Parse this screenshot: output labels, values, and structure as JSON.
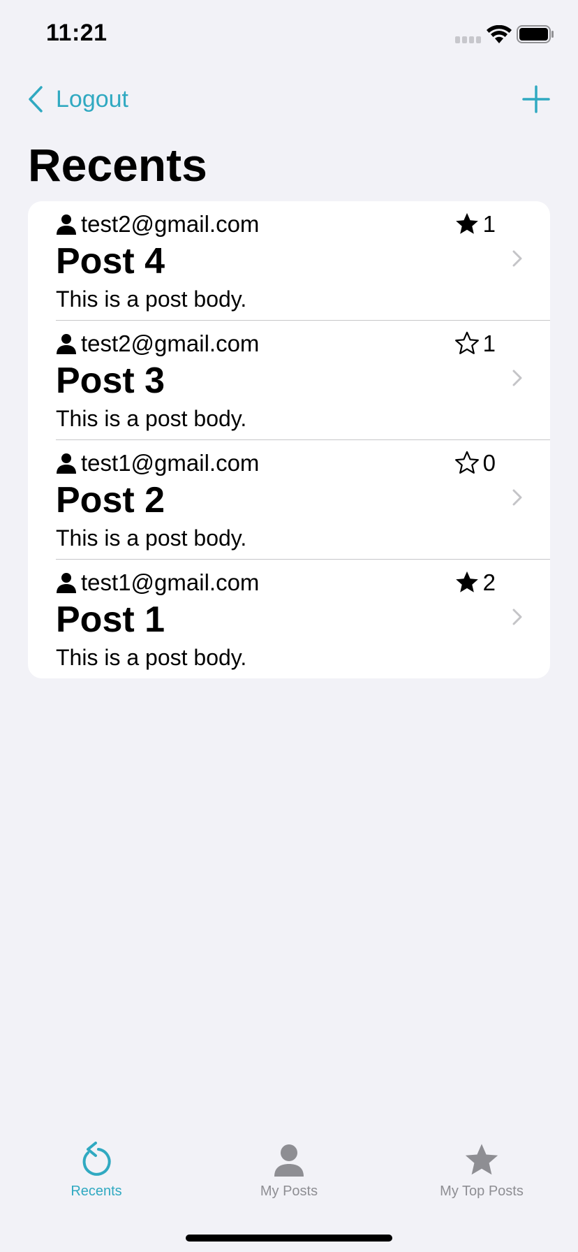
{
  "status": {
    "time": "11:21"
  },
  "nav": {
    "back_label": "Logout",
    "title": "Recents",
    "add_icon": "plus-icon"
  },
  "colors": {
    "accent": "#30a9c1",
    "background": "#f2f2f7",
    "inactive": "#8e8e93"
  },
  "posts": [
    {
      "author": "test2@gmail.com",
      "title": "Post 4",
      "body": "This is a post body.",
      "stars": "1",
      "starred": true
    },
    {
      "author": "test2@gmail.com",
      "title": "Post 3",
      "body": "This is a post body.",
      "stars": "1",
      "starred": false
    },
    {
      "author": "test1@gmail.com",
      "title": "Post 2",
      "body": "This is a post body.",
      "stars": "0",
      "starred": false
    },
    {
      "author": "test1@gmail.com",
      "title": "Post 1",
      "body": "This is a post body.",
      "stars": "2",
      "starred": true
    }
  ],
  "tabs": [
    {
      "label": "Recents",
      "icon": "recents-icon",
      "active": true
    },
    {
      "label": "My Posts",
      "icon": "person-icon",
      "active": false
    },
    {
      "label": "My Top Posts",
      "icon": "star-icon",
      "active": false
    }
  ]
}
